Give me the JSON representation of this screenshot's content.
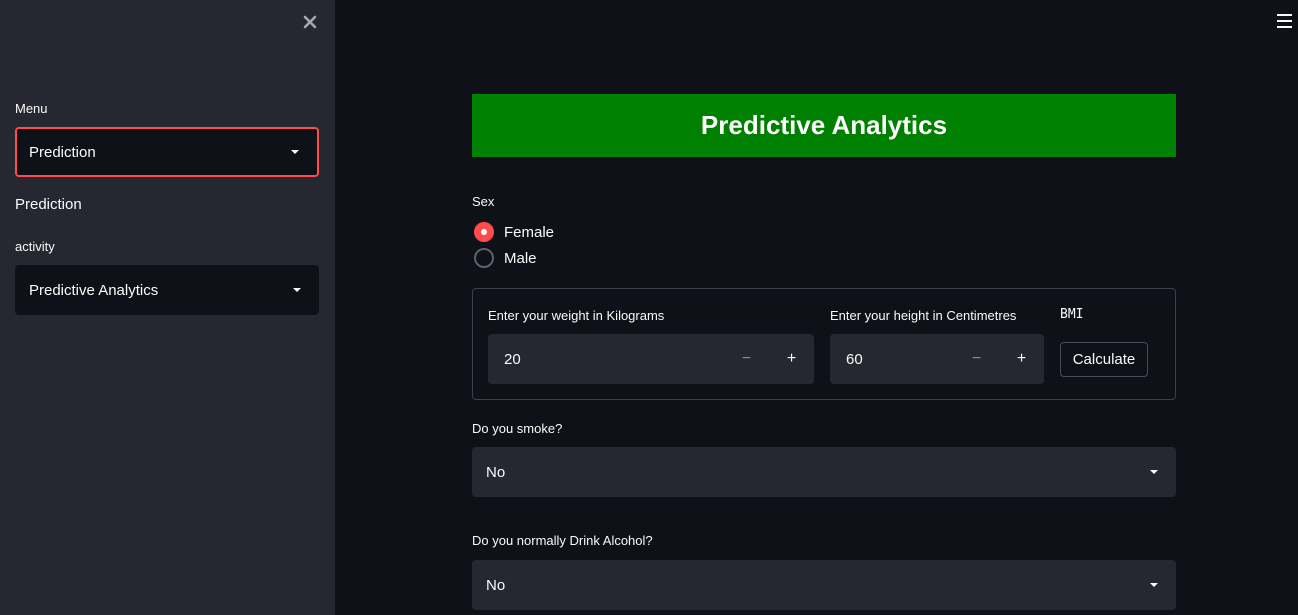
{
  "sidebar": {
    "menu_label": "Menu",
    "menu_value": "Prediction",
    "section_text": "Prediction",
    "activity_label": "activity",
    "activity_value": "Predictive Analytics"
  },
  "main": {
    "banner_title": "Predictive Analytics",
    "sex_label": "Sex",
    "sex_options": [
      {
        "label": "Female",
        "checked": true
      },
      {
        "label": "Male",
        "checked": false
      }
    ],
    "weight_label": "Enter your weight in Kilograms",
    "weight_value": "20",
    "height_label": "Enter your height in Centimetres",
    "height_value": "60",
    "bmi_label": "BMI",
    "calculate_label": "Calculate",
    "smoke_label": "Do you smoke?",
    "smoke_value": "No",
    "alcohol_label": "Do you normally Drink Alcohol?",
    "alcohol_value": "No",
    "minus_symbol": "−",
    "plus_symbol": "+"
  },
  "colors": {
    "banner": "#008000",
    "accent": "#ff4b4b",
    "sidebar_bg": "#262730",
    "main_bg": "#0e1117"
  },
  "icons": {
    "close": "close-icon",
    "hamburger": "hamburger-menu-icon",
    "dropdown": "chevron-down-icon"
  }
}
